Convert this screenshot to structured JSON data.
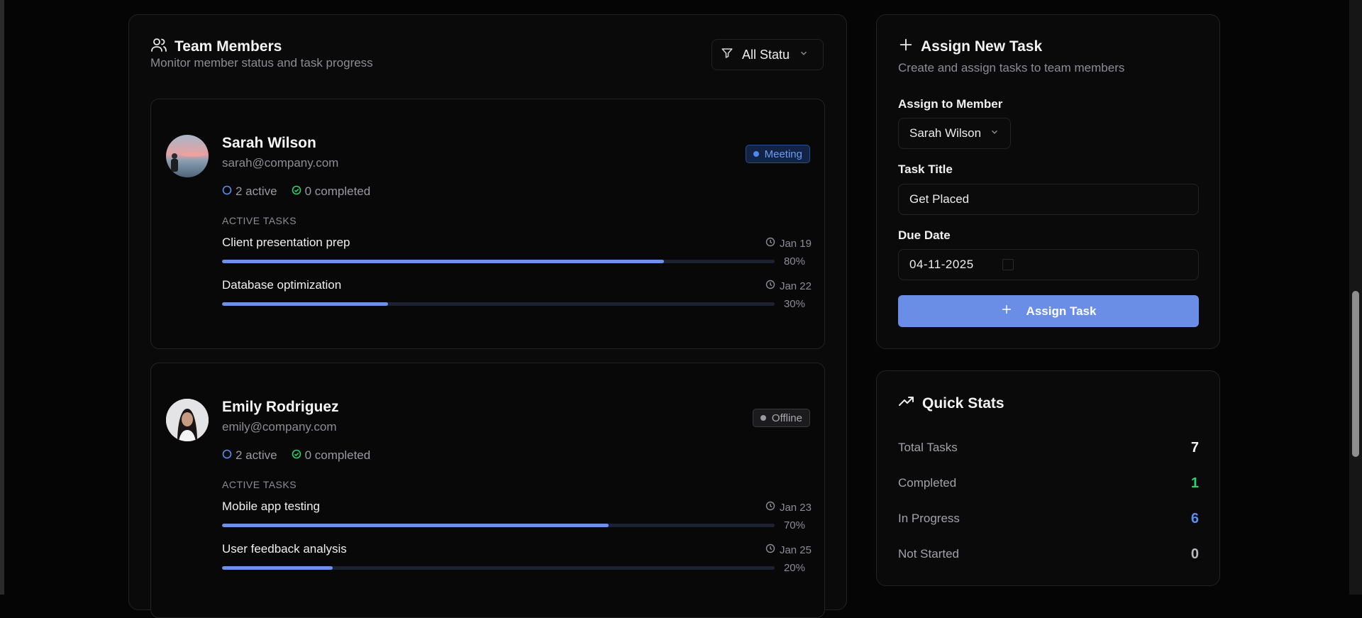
{
  "team": {
    "title": "Team Members",
    "subtitle": "Monitor member status and task progress",
    "filter_value": "All Status",
    "members": [
      {
        "name": "Sarah Wilson",
        "email": "sarah@company.com",
        "status": "Meeting",
        "active_count": "2 active",
        "completed_count": "0 completed",
        "section_label": "ACTIVE TASKS",
        "tasks": [
          {
            "name": "Client presentation prep",
            "due": "Jan 19",
            "progress": 80,
            "progress_label": "80%"
          },
          {
            "name": "Database optimization",
            "due": "Jan 22",
            "progress": 30,
            "progress_label": "30%"
          }
        ]
      },
      {
        "name": "Emily Rodriguez",
        "email": "emily@company.com",
        "status": "Offline",
        "active_count": "2 active",
        "completed_count": "0 completed",
        "section_label": "ACTIVE TASKS",
        "tasks": [
          {
            "name": "Mobile app testing",
            "due": "Jan 23",
            "progress": 70,
            "progress_label": "70%"
          },
          {
            "name": "User feedback analysis",
            "due": "Jan 25",
            "progress": 20,
            "progress_label": "20%"
          }
        ]
      }
    ]
  },
  "assign": {
    "title": "Assign New Task",
    "subtitle": "Create and assign tasks to team members",
    "member_label": "Assign to Member",
    "member_value": "Sarah Wilson",
    "task_title_label": "Task Title",
    "task_title_value": "Get Placed",
    "due_date_label": "Due Date",
    "due_date_value": "04-11-2025",
    "button_label": "Assign Task"
  },
  "stats": {
    "title": "Quick Stats",
    "rows": [
      {
        "label": "Total Tasks",
        "value": "7",
        "color": "#f3f3f4"
      },
      {
        "label": "Completed",
        "value": "1",
        "color": "#2fd06a"
      },
      {
        "label": "In Progress",
        "value": "6",
        "color": "#5b8ff0"
      },
      {
        "label": "Not Started",
        "value": "0",
        "color": "#b9b9be"
      }
    ]
  },
  "colors": {
    "accent": "#6a8ee6",
    "meeting": "#6c9cf6",
    "offline": "#a9a9ad",
    "active_ring": "#5b8ff0",
    "completed_check": "#2fd06a"
  }
}
